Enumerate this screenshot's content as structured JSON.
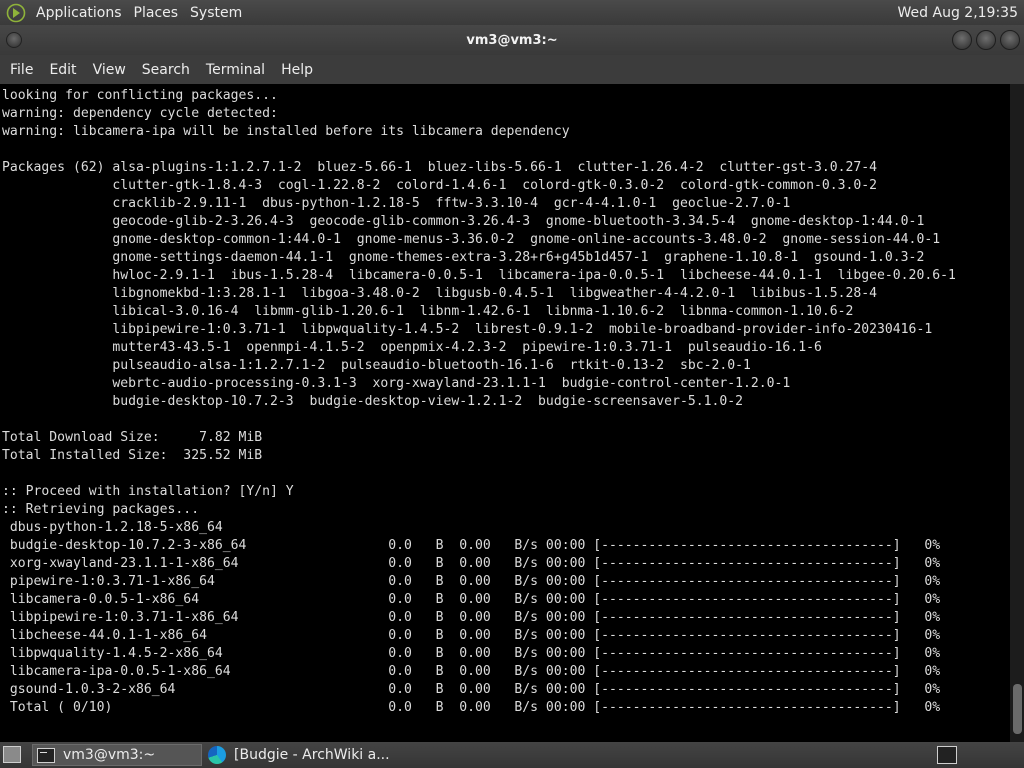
{
  "top_panel": {
    "menus": [
      "Applications",
      "Places",
      "System"
    ],
    "clock": "Wed Aug  2,19:35"
  },
  "window": {
    "title": "vm3@vm3:~"
  },
  "menubar": {
    "items": [
      "File",
      "Edit",
      "View",
      "Search",
      "Terminal",
      "Help"
    ]
  },
  "terminal": {
    "lines": [
      "looking for conflicting packages...",
      "warning: dependency cycle detected:",
      "warning: libcamera-ipa will be installed before its libcamera dependency",
      "",
      "Packages (62) alsa-plugins-1:1.2.7.1-2  bluez-5.66-1  bluez-libs-5.66-1  clutter-1.26.4-2  clutter-gst-3.0.27-4",
      "              clutter-gtk-1.8.4-3  cogl-1.22.8-2  colord-1.4.6-1  colord-gtk-0.3.0-2  colord-gtk-common-0.3.0-2",
      "              cracklib-2.9.11-1  dbus-python-1.2.18-5  fftw-3.3.10-4  gcr-4-4.1.0-1  geoclue-2.7.0-1",
      "              geocode-glib-2-3.26.4-3  geocode-glib-common-3.26.4-3  gnome-bluetooth-3.34.5-4  gnome-desktop-1:44.0-1",
      "              gnome-desktop-common-1:44.0-1  gnome-menus-3.36.0-2  gnome-online-accounts-3.48.0-2  gnome-session-44.0-1",
      "              gnome-settings-daemon-44.1-1  gnome-themes-extra-3.28+r6+g45b1d457-1  graphene-1.10.8-1  gsound-1.0.3-2",
      "              hwloc-2.9.1-1  ibus-1.5.28-4  libcamera-0.0.5-1  libcamera-ipa-0.0.5-1  libcheese-44.0.1-1  libgee-0.20.6-1",
      "              libgnomekbd-1:3.28.1-1  libgoa-3.48.0-2  libgusb-0.4.5-1  libgweather-4-4.2.0-1  libibus-1.5.28-4",
      "              libical-3.0.16-4  libmm-glib-1.20.6-1  libnm-1.42.6-1  libnma-1.10.6-2  libnma-common-1.10.6-2",
      "              libpipewire-1:0.3.71-1  libpwquality-1.4.5-2  librest-0.9.1-2  mobile-broadband-provider-info-20230416-1",
      "              mutter43-43.5-1  openmpi-4.1.5-2  openpmix-4.2.3-2  pipewire-1:0.3.71-1  pulseaudio-16.1-6",
      "              pulseaudio-alsa-1:1.2.7.1-2  pulseaudio-bluetooth-16.1-6  rtkit-0.13-2  sbc-2.0-1",
      "              webrtc-audio-processing-0.3.1-3  xorg-xwayland-23.1.1-1  budgie-control-center-1.2.0-1",
      "              budgie-desktop-10.7.2-3  budgie-desktop-view-1.2.1-2  budgie-screensaver-5.1.0-2",
      "",
      "Total Download Size:     7.82 MiB",
      "Total Installed Size:  325.52 MiB",
      "",
      ":: Proceed with installation? [Y/n] Y",
      ":: Retrieving packages...",
      " dbus-python-1.2.18-5-x86_64",
      " budgie-desktop-10.7.2-3-x86_64                  0.0   B  0.00   B/s 00:00 [-------------------------------------]   0%",
      " xorg-xwayland-23.1.1-1-x86_64                   0.0   B  0.00   B/s 00:00 [-------------------------------------]   0%",
      " pipewire-1:0.3.71-1-x86_64                      0.0   B  0.00   B/s 00:00 [-------------------------------------]   0%",
      " libcamera-0.0.5-1-x86_64                        0.0   B  0.00   B/s 00:00 [-------------------------------------]   0%",
      " libpipewire-1:0.3.71-1-x86_64                   0.0   B  0.00   B/s 00:00 [-------------------------------------]   0%",
      " libcheese-44.0.1-1-x86_64                       0.0   B  0.00   B/s 00:00 [-------------------------------------]   0%",
      " libpwquality-1.4.5-2-x86_64                     0.0   B  0.00   B/s 00:00 [-------------------------------------]   0%",
      " libcamera-ipa-0.0.5-1-x86_64                    0.0   B  0.00   B/s 00:00 [-------------------------------------]   0%",
      " gsound-1.0.3-2-x86_64                           0.0   B  0.00   B/s 00:00 [-------------------------------------]   0%",
      " Total ( 0/10)                                   0.0   B  0.00   B/s 00:00 [-------------------------------------]   0%"
    ]
  },
  "taskbar": {
    "tasks": [
      "vm3@vm3:~",
      "[Budgie - ArchWiki a..."
    ]
  }
}
